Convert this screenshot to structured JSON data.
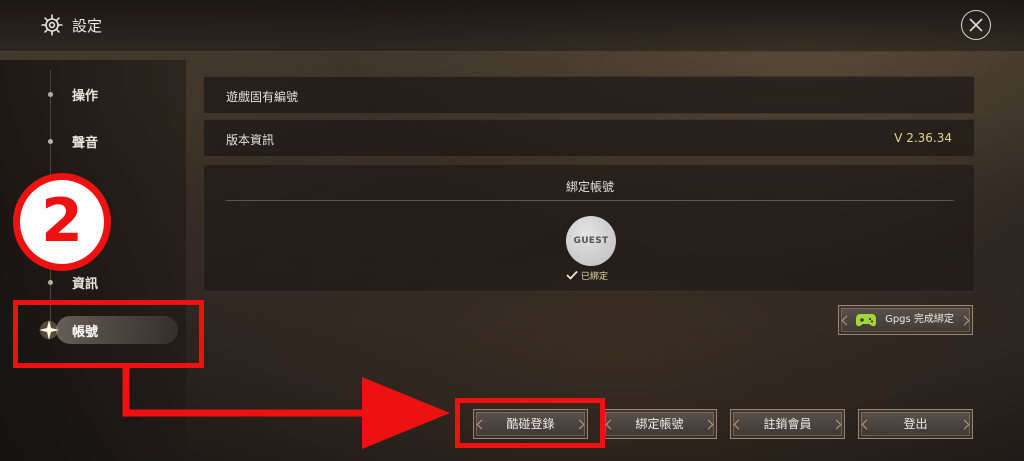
{
  "header": {
    "title": "設定"
  },
  "sidebar": {
    "items": [
      {
        "label": "操作"
      },
      {
        "label": "聲音"
      },
      {
        "label": "資訊"
      },
      {
        "label": "帳號"
      }
    ]
  },
  "main": {
    "rows": [
      {
        "label": "遊戲固有編號",
        "value": ""
      },
      {
        "label": "版本資訊",
        "value": "V 2.36.34"
      }
    ],
    "bind_panel": {
      "title": "綁定帳號",
      "avatar_text": "GUEST",
      "status": "已綁定"
    },
    "gpgs_button": "Gpgs 完成綁定"
  },
  "bottom_buttons": [
    "酷碰登錄",
    "綁定帳號",
    "註銷會員",
    "登出"
  ],
  "annotation": {
    "step_number": "2",
    "color": "#ee1111"
  },
  "colors": {
    "accent": "#e5d38c",
    "gamepad": "#9fd63a"
  }
}
